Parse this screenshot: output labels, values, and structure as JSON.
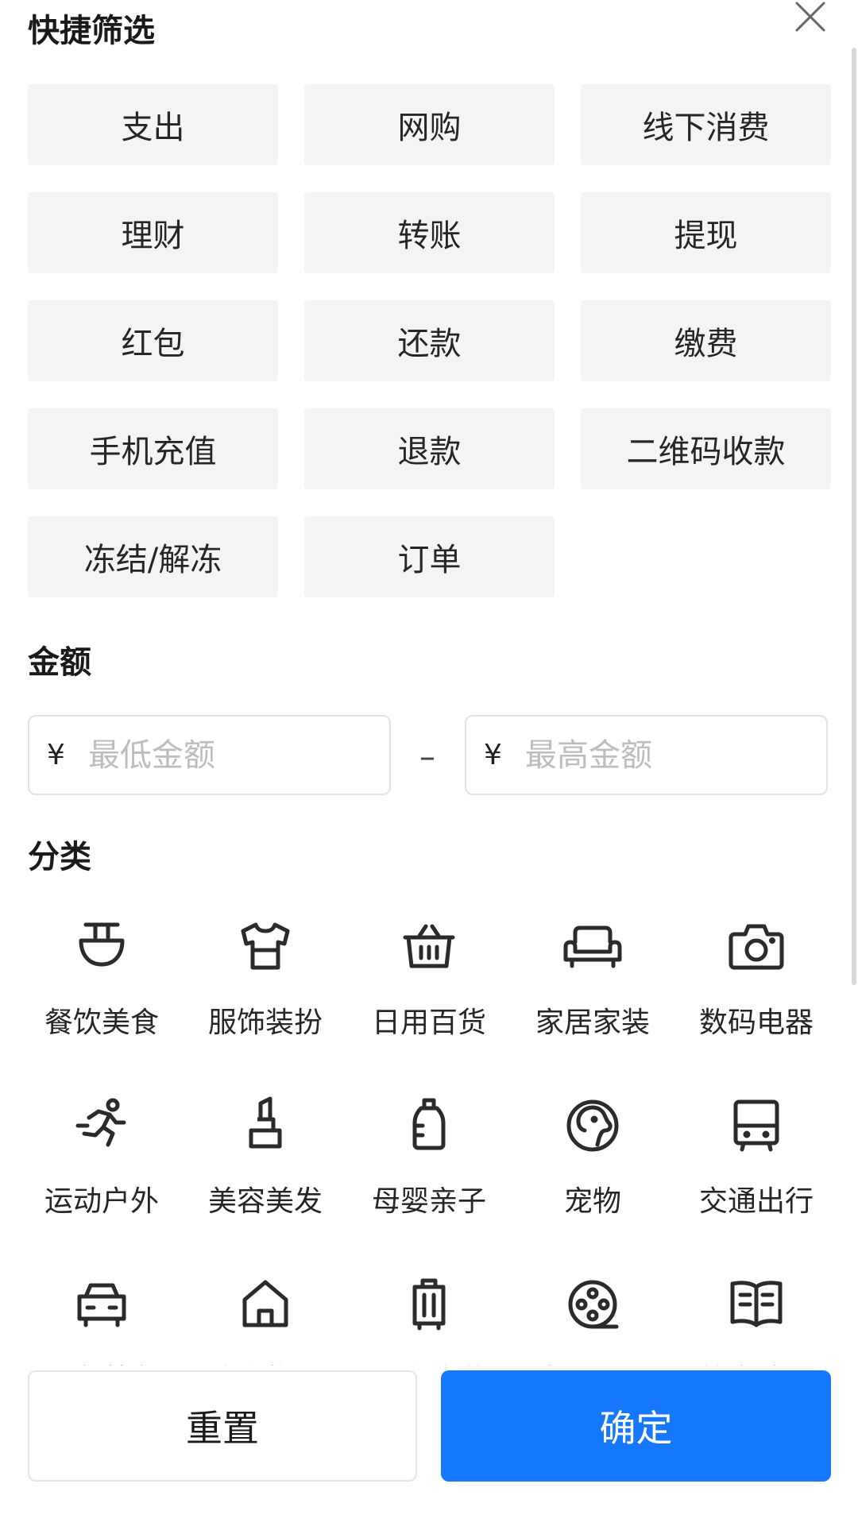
{
  "quick_filter": {
    "title": "快捷筛选",
    "chips": [
      "支出",
      "网购",
      "线下消费",
      "理财",
      "转账",
      "提现",
      "红包",
      "还款",
      "缴费",
      "手机充值",
      "退款",
      "二维码收款",
      "冻结/解冻",
      "订单"
    ]
  },
  "amount": {
    "title": "金额",
    "currency_symbol": "¥",
    "min_placeholder": "最低金额",
    "max_placeholder": "最高金额",
    "separator": "–"
  },
  "category": {
    "title": "分类",
    "items": [
      {
        "label": "餐饮美食",
        "icon": "bowl-icon"
      },
      {
        "label": "服饰装扮",
        "icon": "tshirt-icon"
      },
      {
        "label": "日用百货",
        "icon": "basket-icon"
      },
      {
        "label": "家居家装",
        "icon": "sofa-icon"
      },
      {
        "label": "数码电器",
        "icon": "camera-icon"
      },
      {
        "label": "运动户外",
        "icon": "running-icon"
      },
      {
        "label": "美容美发",
        "icon": "lipstick-icon"
      },
      {
        "label": "母婴亲子",
        "icon": "baby-bottle-icon"
      },
      {
        "label": "宠物",
        "icon": "dog-icon"
      },
      {
        "label": "交通出行",
        "icon": "bus-icon"
      },
      {
        "label": "爱车养车",
        "icon": "car-icon"
      },
      {
        "label": "住房物业",
        "icon": "house-icon"
      },
      {
        "label": "酒店旅游",
        "icon": "luggage-icon"
      },
      {
        "label": "文化休闲",
        "icon": "film-reel-icon"
      },
      {
        "label": "教育培训",
        "icon": "book-icon"
      }
    ]
  },
  "footer": {
    "reset_label": "重置",
    "confirm_label": "确定"
  },
  "colors": {
    "primary": "#1677ff",
    "chip_bg": "#f4f4f4"
  }
}
